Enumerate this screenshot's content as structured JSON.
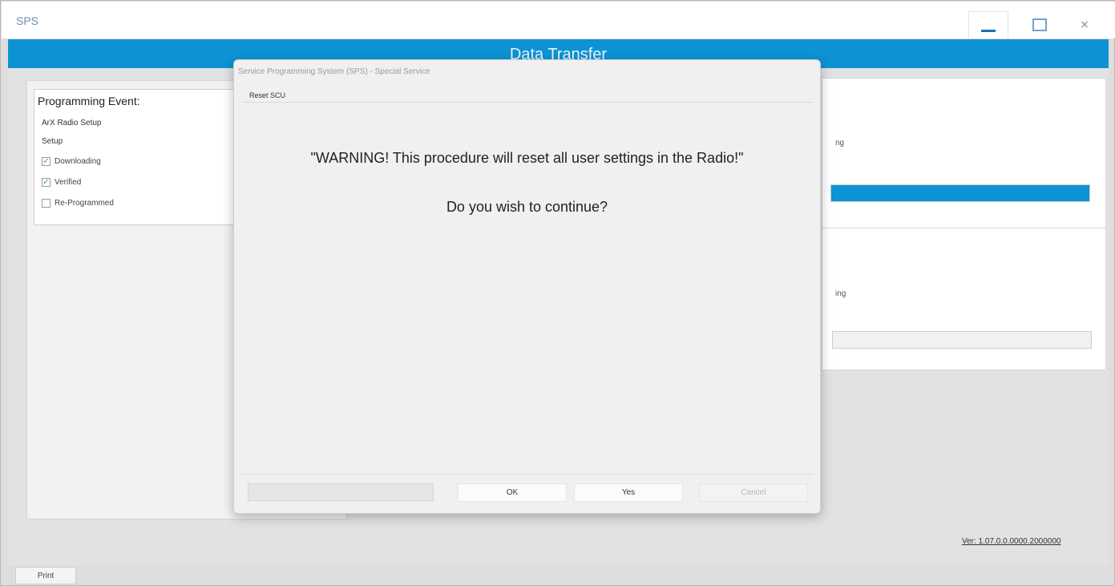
{
  "window": {
    "title": "SPS",
    "minimize_icon": "minimize-icon",
    "maximize_icon": "maximize-icon",
    "close_glyph": "×"
  },
  "banner": {
    "title": "Data Transfer"
  },
  "programming_event": {
    "heading": "Programming Event:",
    "lines": [
      "ArX Radio Setup",
      "Setup"
    ],
    "steps": [
      {
        "label": "Downloading",
        "checked": true
      },
      {
        "label": "Verified",
        "checked": true
      },
      {
        "label": "Re-Programmed",
        "checked": false
      }
    ]
  },
  "right_panel": {
    "status1": "ng",
    "progress1": 100,
    "status2": "ing",
    "progress2": 0
  },
  "version": "Ver: 1.07.0.0.0000.2000000",
  "bottom_button": "Print",
  "dialog": {
    "title": "Service Programming System (SPS) - Special Service",
    "caption": "Reset SCU",
    "warning": "\"WARNING! This procedure will reset all user settings in the Radio!\"",
    "question": "Do you wish to continue?",
    "buttons": {
      "ok": "OK",
      "yes": "Yes",
      "cancel": "Cancel"
    }
  }
}
